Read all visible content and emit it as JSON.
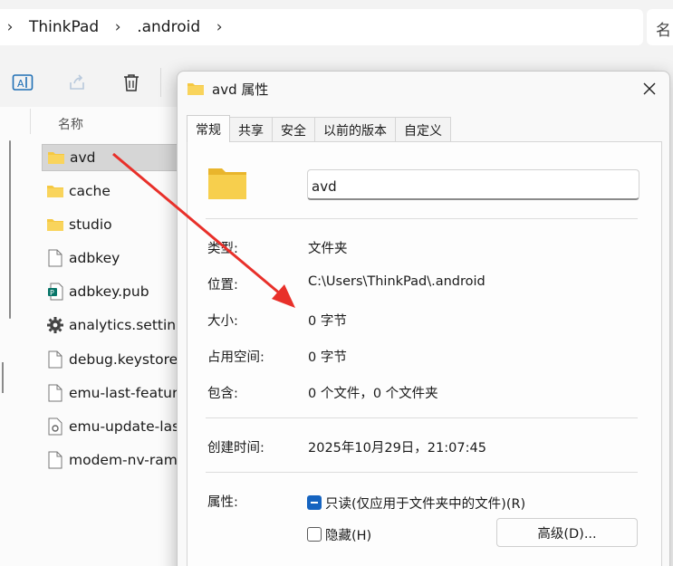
{
  "breadcrumb": {
    "items": [
      "ThinkPad",
      ".android"
    ],
    "stub": "名"
  },
  "toolbar": {
    "buttons": [
      "rename-icon",
      "share-icon",
      "delete-icon"
    ]
  },
  "file_list": {
    "column_header": "名称",
    "files": [
      {
        "name": "avd",
        "icon": "folder-icon",
        "selected": true
      },
      {
        "name": "cache",
        "icon": "folder-icon"
      },
      {
        "name": "studio",
        "icon": "folder-icon"
      },
      {
        "name": "adbkey",
        "icon": "file-icon"
      },
      {
        "name": "adbkey.pub",
        "icon": "publisher-file-icon"
      },
      {
        "name": "analytics.settings",
        "icon": "settings-file-icon"
      },
      {
        "name": "debug.keystore",
        "icon": "file-icon"
      },
      {
        "name": "emu-last-feature",
        "icon": "file-icon"
      },
      {
        "name": "emu-update-last",
        "icon": "config-file-icon"
      },
      {
        "name": "modem-nv-ram-",
        "icon": "file-icon"
      }
    ]
  },
  "dialog": {
    "title": "avd 属性",
    "tabs": [
      "常规",
      "共享",
      "安全",
      "以前的版本",
      "自定义"
    ],
    "active_tab": "常规",
    "name_value": "avd",
    "properties": [
      {
        "label": "类型:",
        "value": "文件夹"
      },
      {
        "label": "位置:",
        "value": "C:\\Users\\ThinkPad\\.android"
      },
      {
        "label": "大小:",
        "value": "0 字节"
      },
      {
        "label": "占用空间:",
        "value": "0 字节"
      },
      {
        "label": "包含:",
        "value": "0 个文件，0 个文件夹"
      },
      {
        "label": "创建时间:",
        "value": "2025年10月29日，21:07:45"
      }
    ],
    "attributes_label": "属性:",
    "readonly_label": "只读(仅应用于文件夹中的文件)(R)",
    "hidden_label": "隐藏(H)",
    "advanced_button": "高级(D)..."
  },
  "colors": {
    "folder": "#f5c841",
    "checkbox_accent": "#1664c0",
    "annotation_arrow": "#e8302a"
  }
}
